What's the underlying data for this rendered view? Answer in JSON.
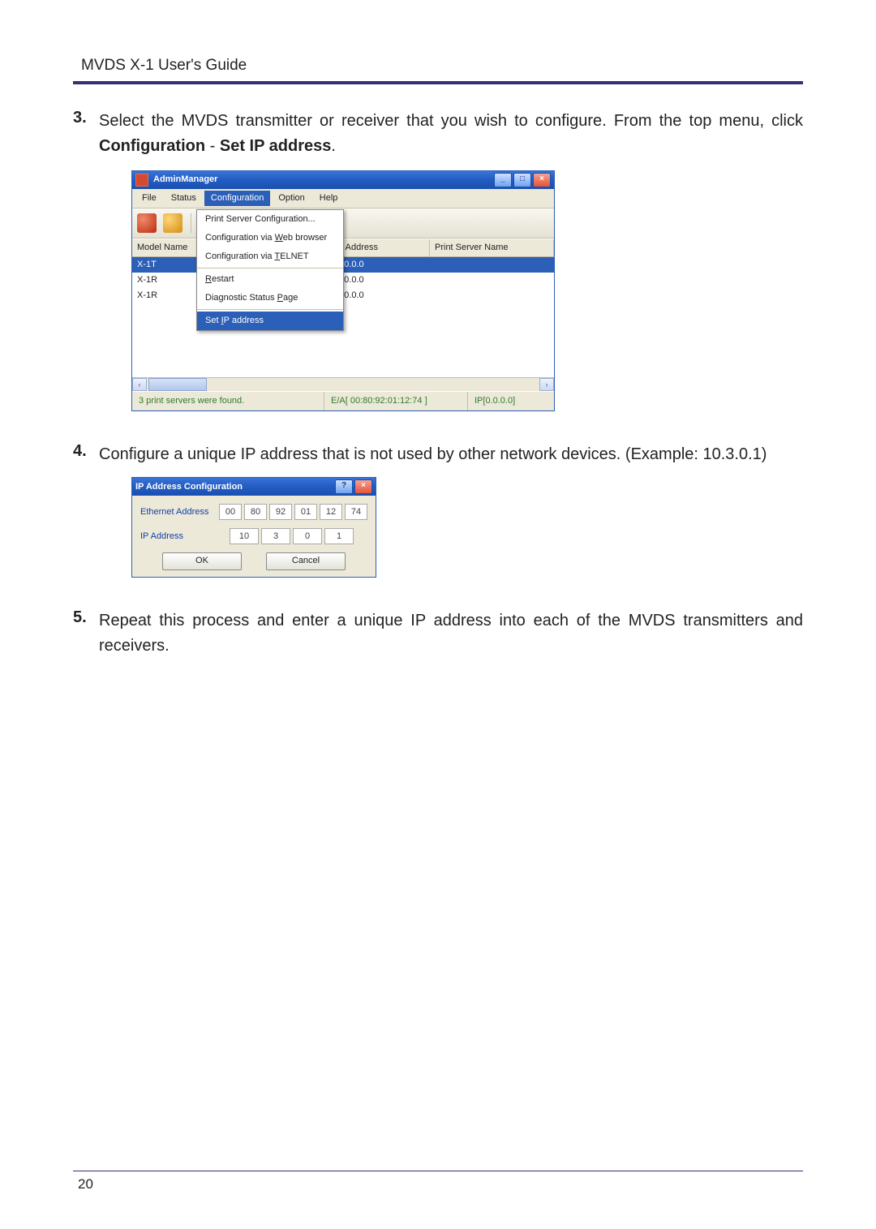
{
  "doc": {
    "header_title": "MVDS X-1 User's Guide",
    "page_number": "20"
  },
  "steps": {
    "s3": {
      "num": "3.",
      "text_a": "Select the MVDS transmitter or receiver that you wish to configure. From the top menu, click ",
      "bold_a": "Configuration",
      "dash": " - ",
      "bold_b": "Set IP address",
      "period": "."
    },
    "s4": {
      "num": "4.",
      "text": "Configure a unique IP address that is not used by other network devices. (Example: 10.3.0.1)"
    },
    "s5": {
      "num": "5.",
      "text": "Repeat this process and enter a unique IP address into each of the MVDS transmitters and receivers."
    }
  },
  "app": {
    "title": "AdminManager",
    "menu": {
      "file": "File",
      "status": "Status",
      "configuration": "Configuration",
      "option": "Option",
      "help": "Help"
    },
    "dropdown": {
      "i1": "Print Server Configuration...",
      "i2_pre": "Configuration via ",
      "i2_u": "W",
      "i2_post": "eb browser",
      "i3_pre": "Configuration via ",
      "i3_u": "T",
      "i3_post": "ELNET",
      "i4_u": "R",
      "i4_post": "estart",
      "i5_pre": "Diagnostic Status ",
      "i5_u": "P",
      "i5_post": "age",
      "i6_pre": "Set ",
      "i6_u": "I",
      "i6_post": "P address"
    },
    "columns": {
      "model": "Model Name",
      "eth": "",
      "ip": "IP Address",
      "psn": "Print Server Name"
    },
    "rows": [
      {
        "model": "X-1T",
        "ip": "0.0.0.0"
      },
      {
        "model": "X-1R",
        "ip": "0.0.0.0"
      },
      {
        "model": "X-1R",
        "ip": "0.0.0.0"
      }
    ],
    "status": {
      "found": "3 print servers were found.",
      "mac": "E/A[ 00:80:92:01:12:74 ]",
      "ip": "IP[0.0.0.0]"
    },
    "scroll": {
      "left": "‹",
      "right": "›"
    },
    "winbtn": {
      "min": "_",
      "max": "□",
      "close": "×",
      "help": "?"
    }
  },
  "dialog": {
    "title": "IP Address Configuration",
    "eth_label": "Ethernet Address",
    "ip_label": "IP Address",
    "eth": [
      "00",
      "80",
      "92",
      "01",
      "12",
      "74"
    ],
    "ip": [
      "10",
      "3",
      "0",
      "1"
    ],
    "ok": "OK",
    "cancel": "Cancel"
  }
}
